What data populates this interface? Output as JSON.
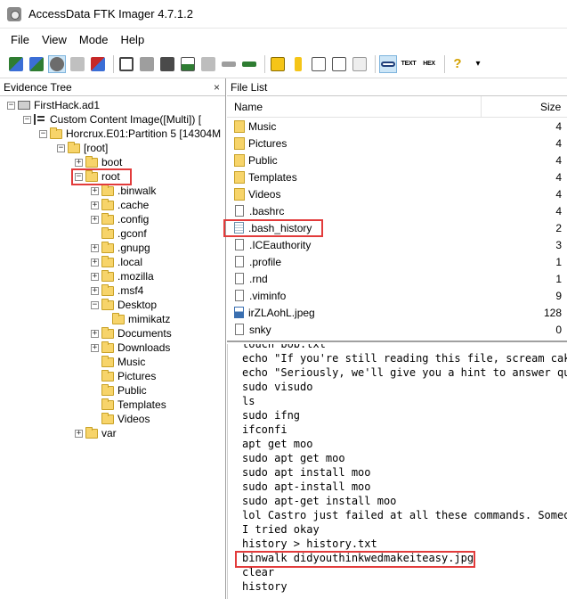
{
  "window": {
    "title": "AccessData FTK Imager 4.7.1.2"
  },
  "menu": [
    "File",
    "View",
    "Mode",
    "Help"
  ],
  "toolbar": {
    "icons": [
      "add-evidence-icon",
      "add-all-evidence-icon",
      "image-mounting-icon",
      "remove-evidence-icon",
      "remove-all-icon",
      "create-disk-image-icon",
      "export-disk-image-icon",
      "export-files-icon",
      "export-hash-icon",
      "add-custom-image-icon",
      "verify-drive-icon",
      "capture-memory-icon",
      "obtain-protected-files-icon",
      "detect-encryption-icon",
      "view-files-icon",
      "view-properties-icon",
      "view-hex-icon",
      "help-icon"
    ],
    "text_button": "TEXT",
    "hex_button": "HEX",
    "help": "?",
    "dropdown": "▾"
  },
  "evidence_tree": {
    "title": "Evidence Tree",
    "close": "×",
    "nodes": {
      "n0": "FirstHack.ad1",
      "n1": "Custom Content Image([Multi]) [",
      "n2": "Horcrux.E01:Partition 5 [14304M",
      "n3": "[root]",
      "n4": "boot",
      "n5": "root",
      "n6": ".binwalk",
      "n7": ".cache",
      "n8": ".config",
      "n9": ".gconf",
      "n10": ".gnupg",
      "n11": ".local",
      "n12": ".mozilla",
      "n13": ".msf4",
      "n14": "Desktop",
      "n15": "mimikatz",
      "n16": "Documents",
      "n17": "Downloads",
      "n18": "Music",
      "n19": "Pictures",
      "n20": "Public",
      "n21": "Templates",
      "n22": "Videos",
      "n23": "var"
    }
  },
  "file_list": {
    "title": "File List",
    "columns": {
      "name": "Name",
      "size": "Size"
    },
    "rows": [
      {
        "name": "Music",
        "size": "4"
      },
      {
        "name": "Pictures",
        "size": "4"
      },
      {
        "name": "Public",
        "size": "4"
      },
      {
        "name": "Templates",
        "size": "4"
      },
      {
        "name": "Videos",
        "size": "4"
      },
      {
        "name": ".bashrc",
        "size": "4"
      },
      {
        "name": ".bash_history",
        "size": "2"
      },
      {
        "name": ".ICEauthority",
        "size": "3"
      },
      {
        "name": ".profile",
        "size": "1"
      },
      {
        "name": ".rnd",
        "size": "1"
      },
      {
        "name": ".viminfo",
        "size": "9"
      },
      {
        "name": "irZLAohL.jpeg",
        "size": "128"
      },
      {
        "name": "snky",
        "size": "0"
      }
    ]
  },
  "text_view": {
    "lines": [
      "touch bob.txt",
      "echo \"If you're still reading this file, scream cake",
      "echo \"Seriously, we'll give you a hint to answer que",
      "sudo visudo",
      "ls",
      "sudo ifng",
      "ifconfi",
      "apt get moo",
      "sudo apt get moo",
      "sudo apt install moo",
      "sudo apt-install moo",
      "sudo apt-get install moo",
      "lol Castro just failed at all these commands. Someon",
      "I tried okay",
      "history > history.txt",
      "binwalk didyouthinkwedmakeiteasy.jpg",
      "clear",
      "history"
    ]
  },
  "colors": {
    "highlight": "#e23b3b",
    "folder": "#f7d46a",
    "active_tool": "#cde6f7"
  }
}
